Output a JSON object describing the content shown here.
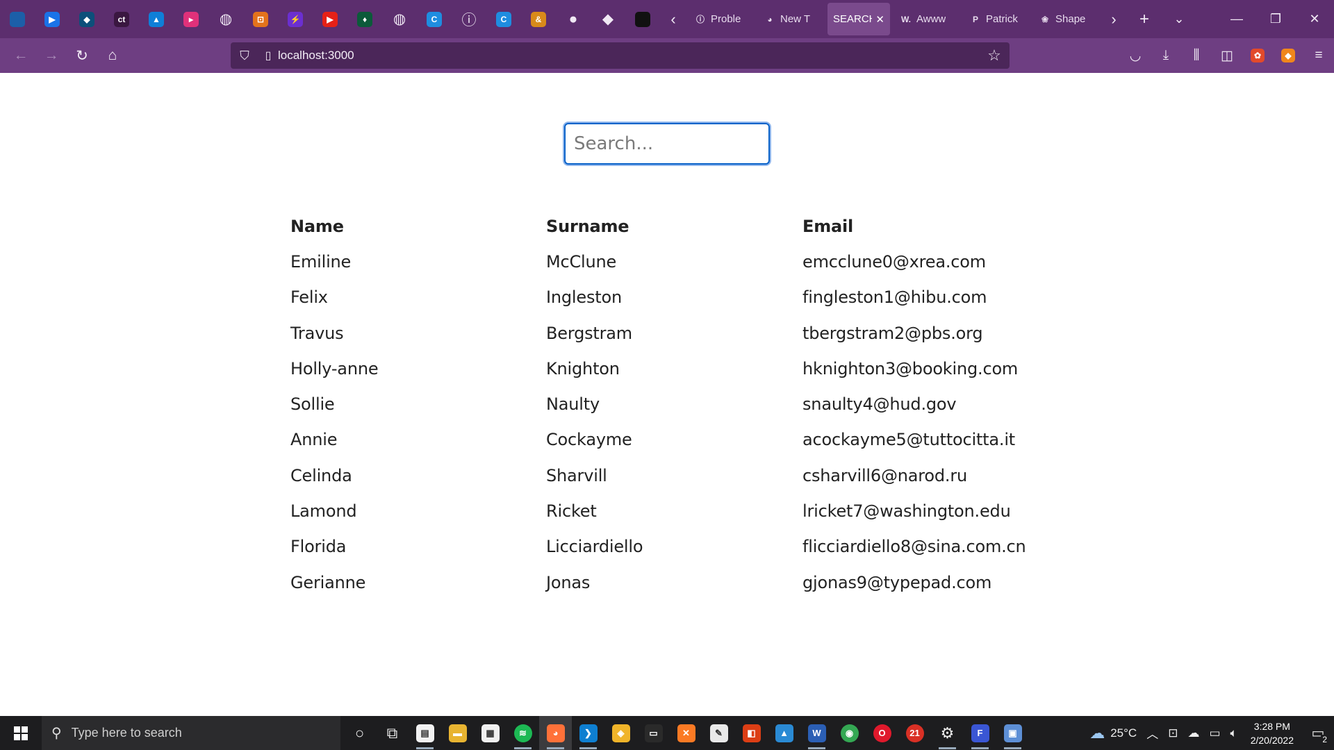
{
  "browser": {
    "pinned_tabs": [
      {
        "icon": "azure-devops-icon",
        "text": "",
        "bg": "#1c5fa8"
      },
      {
        "icon": "play-app-icon",
        "text": "▶",
        "bg": "#1a73e8"
      },
      {
        "icon": "diamond-app-icon",
        "text": "◆",
        "bg": "#0c4f7a"
      },
      {
        "icon": "clickup-icon",
        "text": "ct",
        "bg": "#3a1740"
      },
      {
        "icon": "azure-icon",
        "text": "▲",
        "bg": "#0f7fd8"
      },
      {
        "icon": "pink-app-icon",
        "text": "▸",
        "bg": "#e0317a"
      },
      {
        "icon": "globe-icon",
        "text": "◍",
        "bg": "transparent"
      },
      {
        "icon": "orange-app-icon",
        "text": "⊡",
        "bg": "#e3731c"
      },
      {
        "icon": "purple-app-icon",
        "text": "⚡",
        "bg": "#6b2fd0"
      },
      {
        "icon": "youtube-icon",
        "text": "▶",
        "bg": "#e62117"
      },
      {
        "icon": "leaf-app-icon",
        "text": "♦",
        "bg": "#0b5a3a"
      },
      {
        "icon": "globe-icon",
        "text": "◍",
        "bg": "transparent"
      },
      {
        "icon": "c-app-icon",
        "text": "C",
        "bg": "#1f8de0"
      },
      {
        "icon": "info-icon",
        "text": "ⓘ",
        "bg": "transparent"
      },
      {
        "icon": "c-app-icon",
        "text": "C",
        "bg": "#1f8de0"
      },
      {
        "icon": "ampersand-app-icon",
        "text": "&",
        "bg": "#d88a1a"
      },
      {
        "icon": "github-icon",
        "text": "●",
        "bg": "transparent"
      },
      {
        "icon": "ethereum-icon",
        "text": "◆",
        "bg": "transparent"
      },
      {
        "icon": "black-circle-icon",
        "text": "",
        "bg": "#111111"
      }
    ],
    "tabs": [
      {
        "icon": "info-icon",
        "icon_text": "ⓘ",
        "label": "Proble",
        "active": false
      },
      {
        "icon": "firefox-icon",
        "icon_text": "◕",
        "label": "New T",
        "active": false
      },
      {
        "icon": "",
        "icon_text": "",
        "label": "SEARCH",
        "active": true
      },
      {
        "icon": "webflow-icon",
        "icon_text": "W.",
        "label": "Awww",
        "active": false
      },
      {
        "icon": "p-app-icon",
        "icon_text": "P",
        "label": "Patrick",
        "active": false
      },
      {
        "icon": "flower-icon",
        "icon_text": "❀",
        "label": "Shape",
        "active": false
      }
    ],
    "url": "localhost:3000"
  },
  "app": {
    "search": {
      "placeholder": "Search...",
      "value": ""
    },
    "columns": [
      "Name",
      "Surname",
      "Email"
    ],
    "rows": [
      [
        "Emiline",
        "McClune",
        "emcclune0@xrea.com"
      ],
      [
        "Felix",
        "Ingleston",
        "fingleston1@hibu.com"
      ],
      [
        "Travus",
        "Bergstram",
        "tbergstram2@pbs.org"
      ],
      [
        "Holly-anne",
        "Knighton",
        "hknighton3@booking.com"
      ],
      [
        "Sollie",
        "Naulty",
        "snaulty4@hud.gov"
      ],
      [
        "Annie",
        "Cockayme",
        "acockayme5@tuttocitta.it"
      ],
      [
        "Celinda",
        "Sharvill",
        "csharvill6@narod.ru"
      ],
      [
        "Lamond",
        "Ricket",
        "lricket7@washington.edu"
      ],
      [
        "Florida",
        "Licciardiello",
        "flicciardiello8@sina.com.cn"
      ],
      [
        "Gerianne",
        "Jonas",
        "gjonas9@typepad.com"
      ]
    ]
  },
  "taskbar": {
    "search_placeholder": "Type here to search",
    "apps": [
      {
        "icon": "cortana-icon",
        "text": "○",
        "bg": "transparent",
        "running": false
      },
      {
        "icon": "task-view-icon",
        "text": "⧉",
        "bg": "transparent",
        "running": false
      },
      {
        "icon": "notepad-icon",
        "text": "▤",
        "bg": "#f2f2f2",
        "running": true
      },
      {
        "icon": "file-explorer-icon",
        "text": "▬",
        "bg": "#e8b431",
        "running": false
      },
      {
        "icon": "store-icon",
        "text": "▦",
        "bg": "#f0f0f0",
        "running": false
      },
      {
        "icon": "spotify-icon",
        "text": "≋",
        "bg": "#1db954",
        "running": true
      },
      {
        "icon": "firefox-icon",
        "text": "◕",
        "bg": "#ff7139",
        "running": true
      },
      {
        "icon": "vscode-icon",
        "text": "❯",
        "bg": "#0e7fd1",
        "running": true
      },
      {
        "icon": "git-icon",
        "text": "◈",
        "bg": "#f0b429",
        "running": false
      },
      {
        "icon": "terminal-icon",
        "text": "▭",
        "bg": "#2a2a2a",
        "running": false
      },
      {
        "icon": "xampp-icon",
        "text": "✕",
        "bg": "#fb7a24",
        "running": false
      },
      {
        "icon": "editor-icon",
        "text": "✎",
        "bg": "#e9e9e9",
        "running": false
      },
      {
        "icon": "office-icon",
        "text": "◧",
        "bg": "#dc3e15",
        "running": false
      },
      {
        "icon": "photos-icon",
        "text": "▲",
        "bg": "#2a8ad4",
        "running": false
      },
      {
        "icon": "word-icon",
        "text": "W",
        "bg": "#2b5fb5",
        "running": true
      },
      {
        "icon": "chrome-icon",
        "text": "◉",
        "bg": "#34a853",
        "running": false
      },
      {
        "icon": "opera-icon",
        "text": "O",
        "bg": "#e0192c",
        "running": false
      },
      {
        "icon": "chrome-badge-icon",
        "text": "21",
        "bg": "#d93025",
        "running": false
      },
      {
        "icon": "settings-icon",
        "text": "⚙",
        "bg": "transparent",
        "running": true
      },
      {
        "icon": "f-app-icon",
        "text": "F",
        "bg": "#3a56d4",
        "running": true
      },
      {
        "icon": "remote-desktop-icon",
        "text": "▣",
        "bg": "#5d8fd6",
        "running": true
      }
    ],
    "weather": "25°C",
    "time": "3:28 PM",
    "date": "2/20/2022",
    "notification_count": "2"
  }
}
